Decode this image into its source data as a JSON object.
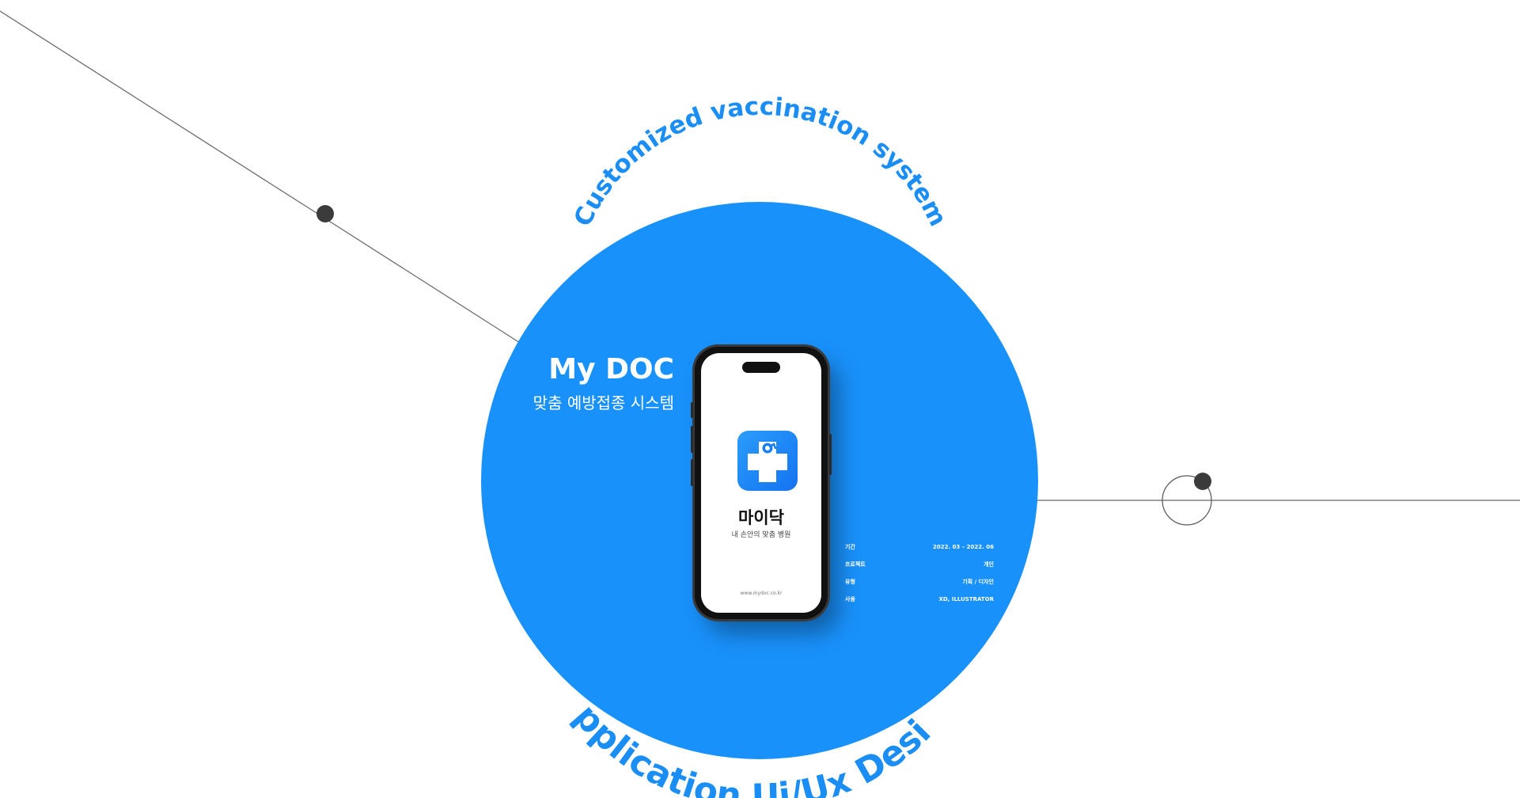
{
  "hero": {
    "arc_top": "Customized vaccination system",
    "arc_bottom": "Application Ui/Ux Design",
    "title": "My DOC",
    "subtitle": "맞춤 예방접종 시스템"
  },
  "phone": {
    "app_name": "마이닥",
    "app_tagline": "내 손안의 맞춤 병원",
    "app_url": "www.mydoc.co.kr"
  },
  "project_info": [
    {
      "label": "기간",
      "value": "2022. 03 – 2022. 06"
    },
    {
      "label": "프로젝트",
      "value": "개인"
    },
    {
      "label": "유형",
      "value": "기획 / 디자인"
    },
    {
      "label": "사용",
      "value": "XD, ILLUSTRATOR"
    }
  ],
  "colors": {
    "accent": "#1991fb",
    "arc_text": "#1a8ef5",
    "line": "#555555",
    "dot": "#3b3b3b"
  }
}
